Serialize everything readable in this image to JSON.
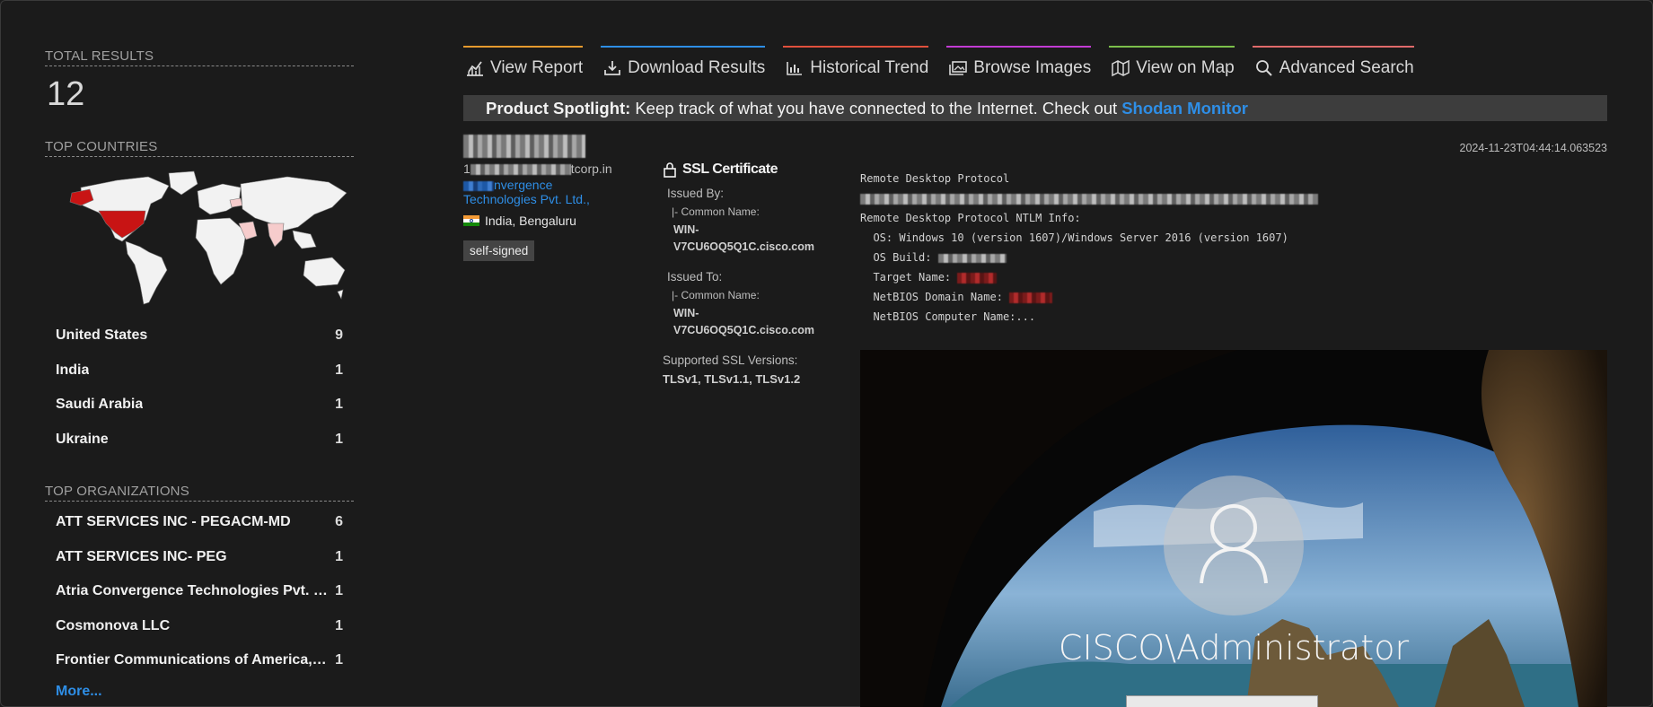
{
  "sidebar": {
    "total_results_label": "TOTAL RESULTS",
    "total_results": "12",
    "top_countries_label": "TOP COUNTRIES",
    "countries": [
      {
        "name": "United States",
        "count": "9"
      },
      {
        "name": "India",
        "count": "1"
      },
      {
        "name": "Saudi Arabia",
        "count": "1"
      },
      {
        "name": "Ukraine",
        "count": "1"
      }
    ],
    "top_orgs_label": "TOP ORGANIZATIONS",
    "orgs": [
      {
        "name": "ATT SERVICES INC - PEGACM-MD",
        "count": "6"
      },
      {
        "name": "ATT SERVICES INC- PEG",
        "count": "1"
      },
      {
        "name": "Atria Convergence Technologies Pvt. …",
        "count": "1"
      },
      {
        "name": "Cosmonova LLC",
        "count": "1"
      },
      {
        "name": "Frontier Communications of America,…",
        "count": "1"
      }
    ],
    "more_label": "More..."
  },
  "toolbar": {
    "items": [
      {
        "label": "View Report",
        "icon": "chart-icon",
        "color": "#e69a2e"
      },
      {
        "label": "Download Results",
        "icon": "download-icon",
        "color": "#2e8ee6"
      },
      {
        "label": "Historical Trend",
        "icon": "bar-chart-icon",
        "color": "#e0503c"
      },
      {
        "label": "Browse Images",
        "icon": "images-icon",
        "color": "#c23bd4"
      },
      {
        "label": "View on Map",
        "icon": "map-icon",
        "color": "#7bc04a"
      },
      {
        "label": "Advanced Search",
        "icon": "search-icon",
        "color": "#e06a6a"
      }
    ]
  },
  "spotlight": {
    "heading": "Product Spotlight:",
    "text": "Keep track of what you have connected to the Internet. Check out",
    "link": "Shodan Monitor"
  },
  "result": {
    "timestamp": "2024-11-23T04:44:14.063523",
    "hostname_suffix": "tcorp.in",
    "hostname_prefix": "1",
    "org_suffix_line1": "nvergence",
    "org_line2": "Technologies Pvt. Ltd.,",
    "location": "India, Bengaluru",
    "tag": "self-signed",
    "ssl": {
      "title": "SSL Certificate",
      "issued_by_label": "Issued By:",
      "issued_by_cn_label": "|- Common Name:",
      "issued_by_cn_line1": "WIN-",
      "issued_by_cn_line2": "V7CU6OQ5Q1C.cisco.com",
      "issued_to_label": "Issued To:",
      "issued_to_cn_label": "|- Common Name:",
      "issued_to_cn_line1": "WIN-",
      "issued_to_cn_line2": "V7CU6OQ5Q1C.cisco.com",
      "versions_label": "Supported SSL Versions:",
      "versions": "TLSv1, TLSv1.1, TLSv1.2"
    },
    "banner": {
      "line1": "Remote Desktop Protocol",
      "line3": "Remote Desktop Protocol NTLM Info:",
      "os": "  OS: Windows 10 (version 1607)/Windows Server 2016 (version 1607)",
      "os_build": "  OS Build: ",
      "target_name": "  Target Name: ",
      "netbios_domain": "  NetBIOS Domain Name: ",
      "netbios_computer": "  NetBIOS Computer Name:..."
    },
    "screenshot_user": "CISCO\\Administrator"
  }
}
